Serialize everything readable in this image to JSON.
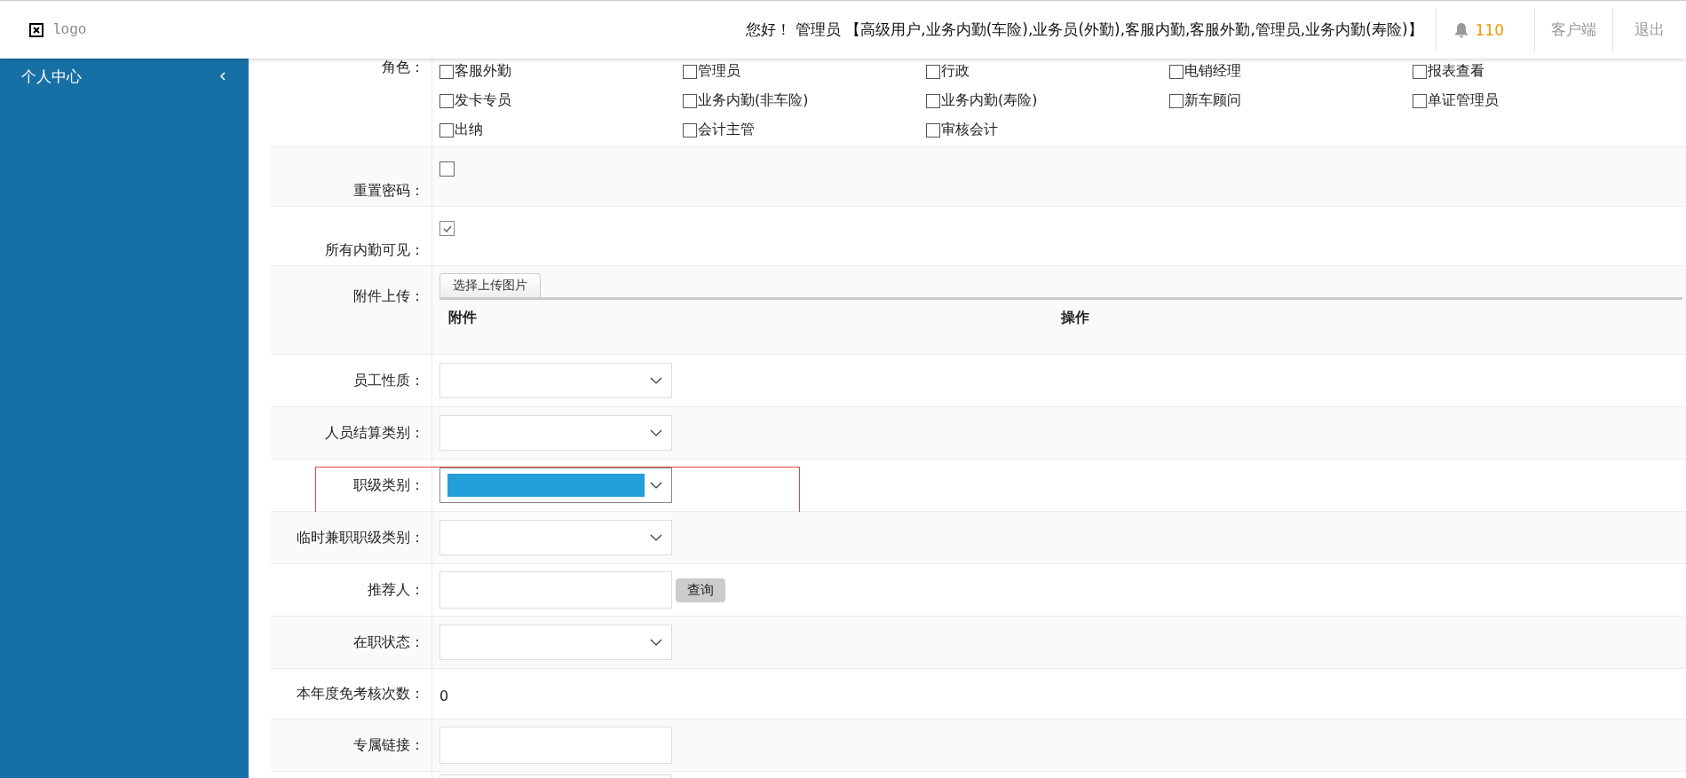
{
  "header": {
    "logo_text": "logo",
    "greeting": "您好！ 管理员 【高级用户,业务内勤(车险),业务员(外勤),客服内勤,客服外勤,管理员,业务内勤(寿险)】",
    "notification_count": "110",
    "links": [
      "客户端",
      "退出"
    ]
  },
  "sidebar": {
    "items": [
      {
        "label": "个人中心",
        "expanded": false
      }
    ]
  },
  "form": {
    "rows": [
      {
        "kind": "roles",
        "label": "角色：",
        "items": [
          {
            "label": "客服外勤",
            "checked": false
          },
          {
            "label": "管理员",
            "checked": false
          },
          {
            "label": "行政",
            "checked": false
          },
          {
            "label": "电销经理",
            "checked": false
          },
          {
            "label": "报表查看",
            "checked": false
          },
          {
            "label": "发卡专员",
            "checked": false
          },
          {
            "label": "业务内勤(非车险)",
            "checked": false
          },
          {
            "label": "业务内勤(寿险)",
            "checked": false
          },
          {
            "label": "新车顾问",
            "checked": false
          },
          {
            "label": "单证管理员",
            "checked": false
          },
          {
            "label": "出纳",
            "checked": false
          },
          {
            "label": "会计主管",
            "checked": false
          },
          {
            "label": "审核会计",
            "checked": false
          }
        ]
      },
      {
        "kind": "checkbox",
        "label": "重置密码：",
        "checked": false
      },
      {
        "kind": "checkbox",
        "label": "所有内勤可见：",
        "checked": true
      },
      {
        "kind": "upload",
        "label": "附件上传：",
        "button": "选择上传图片",
        "columns": [
          "附件",
          "操作"
        ]
      },
      {
        "kind": "select",
        "label": "员工性质：",
        "focused": false,
        "highlighted": false
      },
      {
        "kind": "select",
        "label": "人员结算类别：",
        "focused": false,
        "highlighted": false
      },
      {
        "kind": "select",
        "label": "职级类别：",
        "focused": true,
        "highlighted": true
      },
      {
        "kind": "select",
        "label": "临时兼职职级类别：",
        "focused": false,
        "highlighted": false
      },
      {
        "kind": "input_button",
        "label": "推荐人：",
        "button": "查询"
      },
      {
        "kind": "select",
        "label": "在职状态：",
        "focused": false,
        "highlighted": false
      },
      {
        "kind": "text",
        "label": "本年度免考核次数：",
        "value": "0"
      },
      {
        "kind": "input",
        "label": "专属链接："
      },
      {
        "kind": "input"
      }
    ]
  }
}
